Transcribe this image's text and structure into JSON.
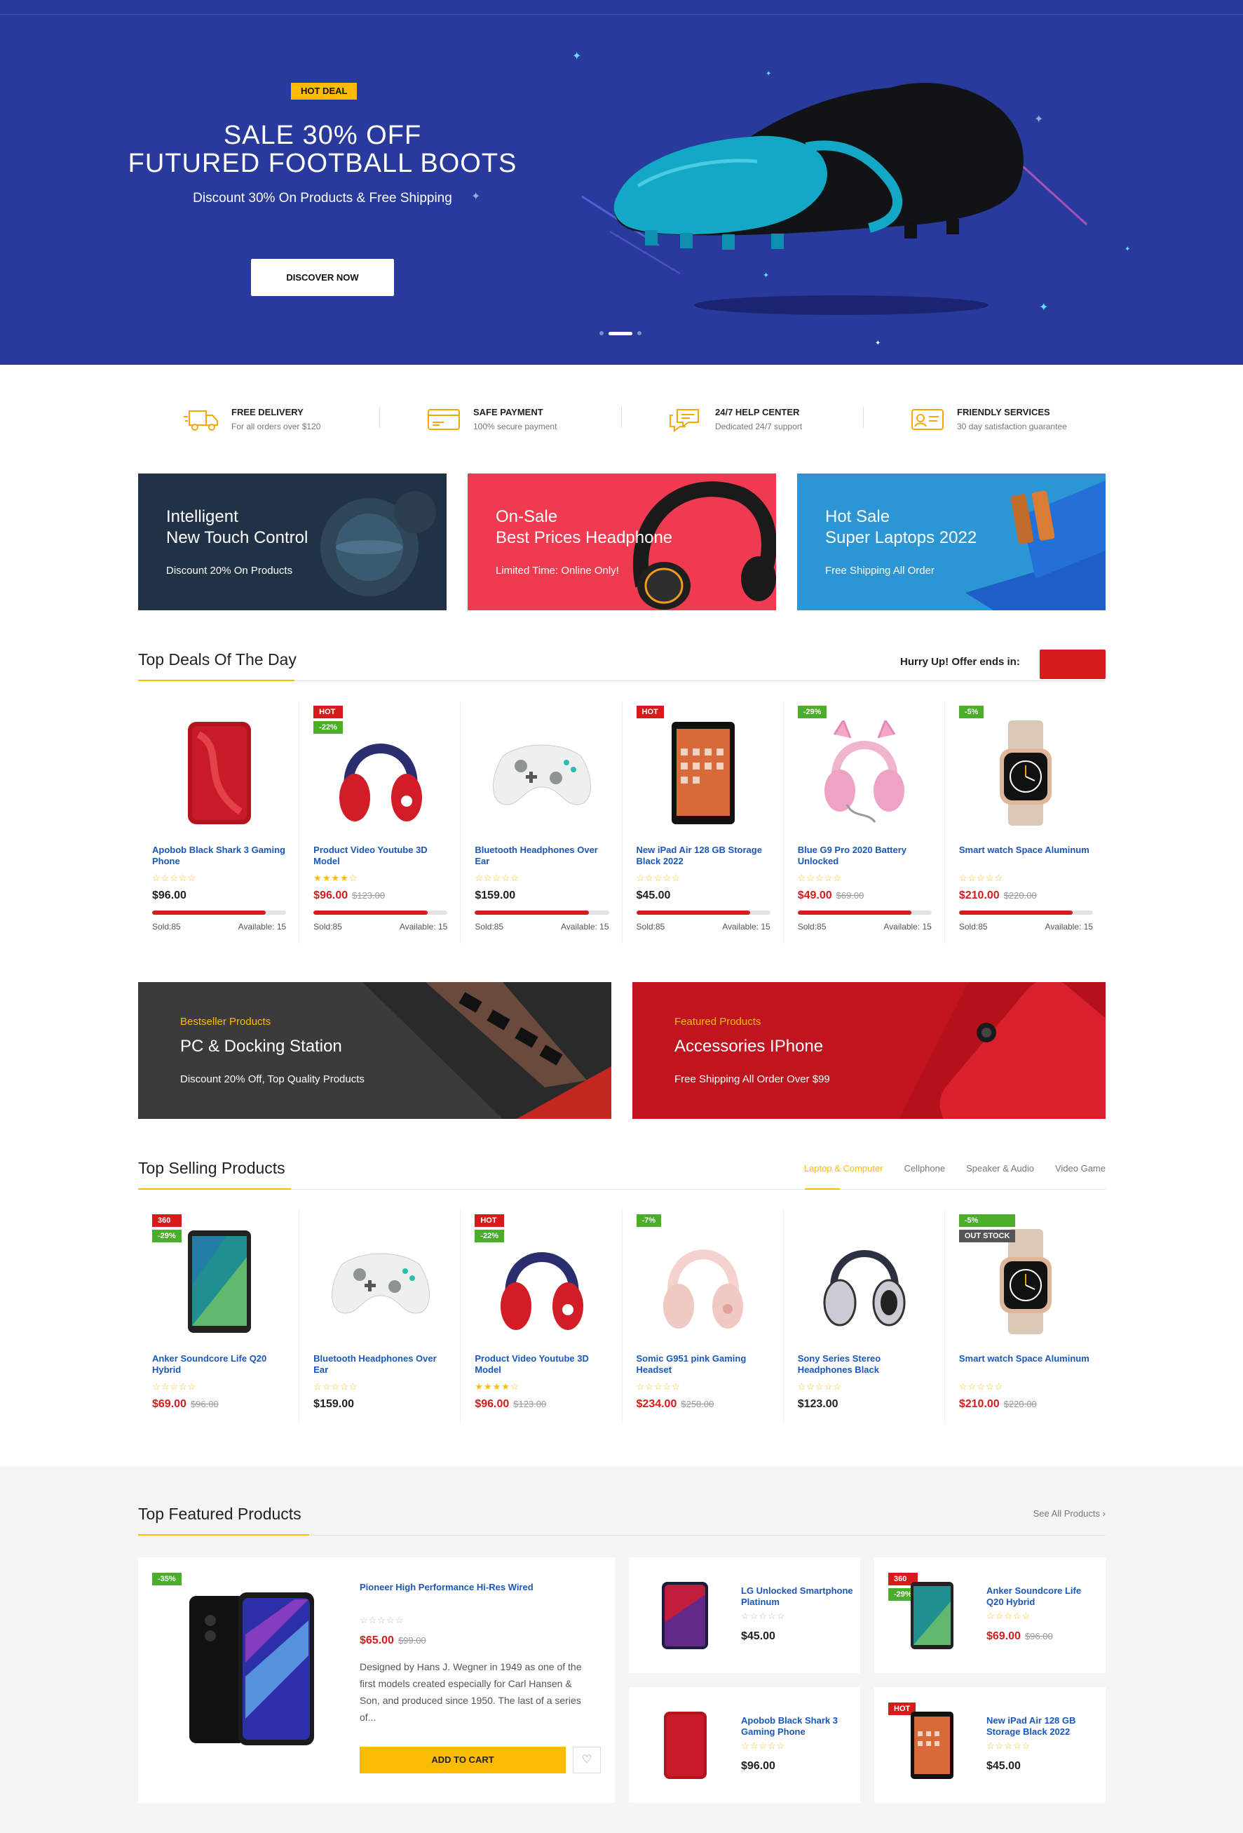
{
  "hero": {
    "badge": "HOT DEAL",
    "title_line1": "SALE 30% OFF",
    "title_line2": "FUTURED FOOTBALL BOOTS",
    "subtitle": "Discount 30% On Products & Free Shipping",
    "button": "DISCOVER NOW",
    "slides": 3,
    "active_slide": 2
  },
  "services": [
    {
      "icon": "truck-icon",
      "title": "FREE DELIVERY",
      "sub": "For all orders over $120"
    },
    {
      "icon": "credit-card-icon",
      "title": "SAFE PAYMENT",
      "sub": "100% secure payment"
    },
    {
      "icon": "chat-support-icon",
      "title": "24/7 HELP CENTER",
      "sub": "Dedicated 24/7 support"
    },
    {
      "icon": "id-card-icon",
      "title": "FRIENDLY SERVICES",
      "sub": "30 day satisfaction guarantee"
    }
  ],
  "promo_banners": [
    {
      "line1": "Intelligent",
      "line2": "New Touch Control",
      "line3": "Discount 20% On Products",
      "color": "#223246"
    },
    {
      "line1": "On-Sale",
      "line2": "Best Prices Headphone",
      "line3": "Limited Time: Online Only!",
      "color": "#ef3a50"
    },
    {
      "line1": "Hot Sale",
      "line2": "Super Laptops 2022",
      "line3": "Free Shipping All Order",
      "color": "#2c95d4"
    }
  ],
  "deals": {
    "title": "Top Deals Of The Day",
    "hurry": "Hurry Up! Offer ends in:",
    "timer": "",
    "products": [
      {
        "name": "Apobob Black Shark 3 Gaming Phone",
        "price": "$96.00",
        "old": "",
        "rating": 0,
        "sold": "Sold:85",
        "avail": "Available: 15",
        "progress": 0.85,
        "badges": []
      },
      {
        "name": "Product Video Youtube 3D Model",
        "price": "$96.00",
        "old": "$123.00",
        "rating": 4,
        "sold": "Sold:85",
        "avail": "Available: 15",
        "progress": 0.85,
        "badges": [
          "HOT",
          "-22%"
        ]
      },
      {
        "name": "Bluetooth Headphones Over Ear",
        "price": "$159.00",
        "old": "",
        "rating": 0,
        "sold": "Sold:85",
        "avail": "Available: 15",
        "progress": 0.85,
        "badges": []
      },
      {
        "name": "New iPad Air 128 GB Storage Black 2022",
        "price": "$45.00",
        "old": "",
        "rating": 0,
        "sold": "Sold:85",
        "avail": "Available: 15",
        "progress": 0.85,
        "badges": [
          "HOT"
        ]
      },
      {
        "name": "Blue G9 Pro 2020 Battery Unlocked",
        "price": "$49.00",
        "old": "$69.00",
        "rating": 0,
        "sold": "Sold:85",
        "avail": "Available: 15",
        "progress": 0.85,
        "badges": [
          "-29%"
        ]
      },
      {
        "name": "Smart watch Space Aluminum",
        "price": "$210.00",
        "old": "$220.00",
        "rating": 0,
        "sold": "Sold:85",
        "avail": "Available: 15",
        "progress": 0.85,
        "badges": [
          "-5%"
        ]
      }
    ]
  },
  "wide_banners": [
    {
      "kicker": "Bestseller Products",
      "title": "PC & Docking Station",
      "sub": "Discount 20% Off, Top Quality Products",
      "color": "#3b3b3b"
    },
    {
      "kicker": "Featured Products",
      "title": "Accessories IPhone",
      "sub": "Free Shipping All Order Over $99",
      "color": "#c0141f"
    }
  ],
  "selling": {
    "title": "Top Selling Products",
    "tabs": [
      "Laptop & Computer",
      "Cellphone",
      "Speaker & Audio",
      "Video Game"
    ],
    "active_tab": 0,
    "products": [
      {
        "name": "Anker Soundcore Life Q20 Hybrid",
        "price": "$69.00",
        "old": "$96.00",
        "rating": 0,
        "badges": [
          "360",
          "-29%"
        ]
      },
      {
        "name": "Bluetooth Headphones Over Ear",
        "price": "$159.00",
        "old": "",
        "rating": 0,
        "badges": []
      },
      {
        "name": "Product Video Youtube 3D Model",
        "price": "$96.00",
        "old": "$123.00",
        "rating": 4,
        "badges": [
          "HOT",
          "-22%"
        ]
      },
      {
        "name": "Somic G951 pink Gaming Headset",
        "price": "$234.00",
        "old": "$250.00",
        "rating": 0,
        "badges": [
          "-7%"
        ]
      },
      {
        "name": "Sony Series Stereo Headphones Black",
        "price": "$123.00",
        "old": "",
        "rating": 0,
        "badges": []
      },
      {
        "name": "Smart watch Space Aluminum",
        "price": "$210.00",
        "old": "$220.00",
        "rating": 0,
        "badges": [
          "-5%",
          "OUT STOCK"
        ]
      }
    ]
  },
  "featured": {
    "title": "Top Featured Products",
    "see_all": "See All Products",
    "main": {
      "badge": "-35%",
      "name": "Pioneer High Performance Hi-Res Wired",
      "price": "$65.00",
      "old": "$99.00",
      "desc": "Designed by Hans J. Wegner in 1949 as one of the first models created especially for Carl Hansen & Son, and produced since 1950. The last of a series of...",
      "cart": "ADD TO CART"
    },
    "items": [
      {
        "name": "LG Unlocked Smartphone Platinum",
        "price": "$45.00",
        "old": "",
        "badges": []
      },
      {
        "name": "Anker Soundcore Life Q20 Hybrid",
        "price": "$69.00",
        "old": "$96.00",
        "badges": [
          "360",
          "-29%"
        ]
      },
      {
        "name": "Apobob Black Shark 3 Gaming Phone",
        "price": "$96.00",
        "old": "",
        "badges": []
      },
      {
        "name": "New iPad Air 128 GB Storage Black 2022",
        "price": "$45.00",
        "old": "",
        "badges": [
          "HOT"
        ]
      }
    ]
  },
  "colors": {
    "accent": "#fcbc05",
    "hero_bg": "#283a9c",
    "sale": "#d61b1b",
    "link": "#1a57b8"
  }
}
